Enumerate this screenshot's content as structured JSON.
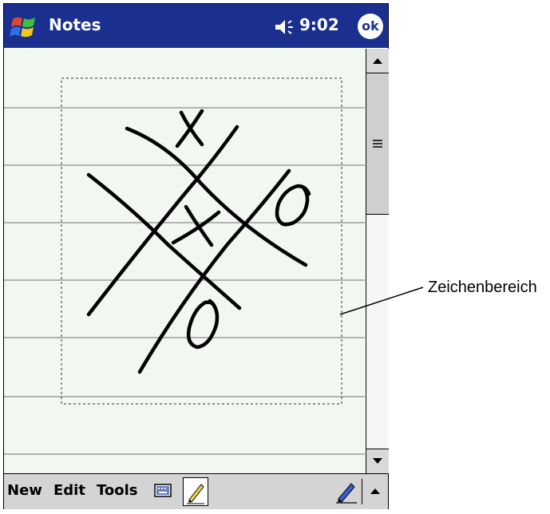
{
  "header": {
    "app_title": "Notes",
    "time": "9:02",
    "ok_label": "ok",
    "start_icon": "windows-flag-icon",
    "volume_icon": "speaker-icon"
  },
  "canvas": {
    "drawing": "tic-tac-toe sketch with X and O marks",
    "ruled_lines": true
  },
  "scrollbar": {
    "up_icon": "arrow-up-icon",
    "down_icon": "arrow-down-icon",
    "thumb_icon": "grip-icon"
  },
  "menu_bar": {
    "items": [
      "New",
      "Edit",
      "Tools"
    ],
    "keyboard_icon": "keyboard-icon",
    "pen_icon": "pen-icon",
    "input_selector_icon": "arrow-up-icon"
  },
  "annotation": {
    "label": "Zeichenbereich"
  },
  "colors": {
    "titlebar": "#1b2f8f",
    "note_bg": "#f3f7f2",
    "toolbar": "#d4d4d4"
  }
}
